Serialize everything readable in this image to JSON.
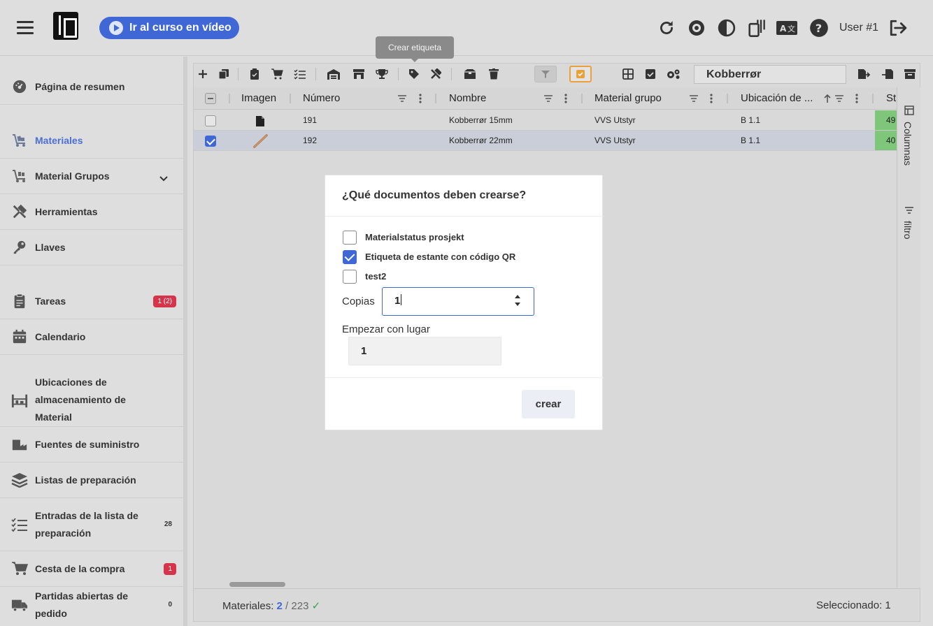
{
  "header": {
    "video_button_label": "Ir al curso en vídeo",
    "user_label": "User #1",
    "icons": [
      "refresh-icon",
      "eye-icon",
      "contrast-icon",
      "devices-icon",
      "translate-icon",
      "help-icon",
      "logout-icon"
    ]
  },
  "tooltip": {
    "text": "Crear etiqueta"
  },
  "sidebar": {
    "items": [
      {
        "label": "Página de resumen",
        "icon": "dashboard-icon"
      },
      {
        "label": "Materiales",
        "icon": "cart-icon",
        "active": true
      },
      {
        "label": "Material Grupos",
        "icon": "cart-group-icon"
      },
      {
        "label": "Herramientas",
        "icon": "tools-icon"
      },
      {
        "label": "Llaves",
        "icon": "key-icon"
      },
      {
        "label": "Tareas",
        "icon": "clipboard-icon",
        "badge": "1 (2)"
      },
      {
        "label": "Calendario",
        "icon": "calendar-icon"
      },
      {
        "label": "Ubicaciones de almacenamiento de Material",
        "icon": "shelf-icon"
      },
      {
        "label": "Fuentes de suministro",
        "icon": "factory-icon"
      },
      {
        "label": "Listas de preparación",
        "icon": "layers-icon"
      },
      {
        "label": "Entradas de la lista de preparación",
        "icon": "checklist-icon",
        "badge": "28"
      },
      {
        "label": "Cesta de la compra",
        "icon": "shopping-cart-icon",
        "badge": "1"
      },
      {
        "label": "Partidas abiertas de pedido",
        "icon": "truck-icon",
        "badge": "0"
      }
    ]
  },
  "toolbar": {
    "search_value": "Kobberrør"
  },
  "table": {
    "columns": [
      "Imagen",
      "Número",
      "Nombre",
      "Material grupo",
      "Ubicación de ...",
      "St"
    ],
    "rows": [
      {
        "numero": "191",
        "nombre": "Kobberrør 15mm",
        "grupo": "VVS Utstyr",
        "ubicacion": "B 1.1",
        "stock": "49",
        "selected": false
      },
      {
        "numero": "192",
        "nombre": "Kobberrør 22mm",
        "grupo": "VVS Utstyr",
        "ubicacion": "B 1.1",
        "stock": "40",
        "selected": true
      }
    ]
  },
  "side_panel": {
    "columns_label": "Columnas",
    "filter_label": "filtro"
  },
  "footer": {
    "materials_label": "Materiales:",
    "shown": "2",
    "total": "/ 223",
    "selected_label": "Seleccionado: 1"
  },
  "dialog": {
    "title": "¿Qué documentos deben crearse?",
    "options": [
      {
        "label": "Materialstatus prosjekt",
        "checked": false
      },
      {
        "label": "Etiqueta de estante con código QR",
        "checked": true
      },
      {
        "label": "test2",
        "checked": false
      }
    ],
    "copias_label": "Copias",
    "copias_value": "1",
    "empezar_label": "Empezar con lugar",
    "empezar_value": "1",
    "create_button": "crear"
  },
  "colors": {
    "accent": "#3f67d6",
    "badge_red": "#d6344a",
    "stock_green": "#7ec77a",
    "highlight_orange": "#e9a23b"
  }
}
